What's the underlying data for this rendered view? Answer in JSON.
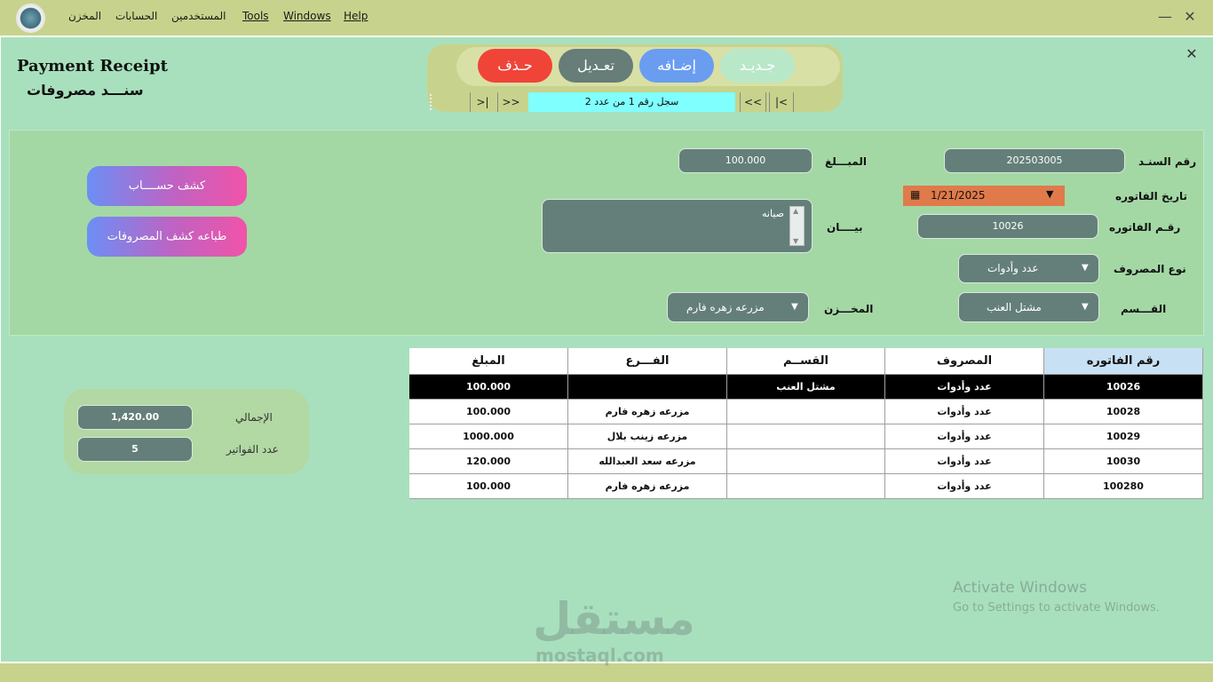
{
  "menu": {
    "store": "المخزن",
    "accounts": "الحسابات",
    "users": "المستخدمين",
    "tools": "Tools",
    "windows": "Windows",
    "help": "Help"
  },
  "window_controls": {
    "minimize": "—",
    "close": "✕"
  },
  "form_close": "✕",
  "title": {
    "en": "Payment Receipt",
    "ar": "سنـــد مصروفات"
  },
  "toolbar": {
    "new_label": "جـديـد",
    "add_label": "إضـافه",
    "edit_label": "تعـديل",
    "delete_label": "حـذف"
  },
  "nav": {
    "first": "|<",
    "prev": "<<",
    "next": ">>",
    "last": ">|",
    "record_info": "سجل رقم   1   من عدد   2"
  },
  "form": {
    "voucher_no_label": "رقم السنـد",
    "voucher_no": "202503005",
    "amount_label": "المبـــلغ",
    "amount": "100.000",
    "invoice_date_label": "تاريخ الفاتوره",
    "invoice_date": "1/21/2025",
    "invoice_no_label": "رقـم الفاتوره",
    "invoice_no": "10026",
    "description_label": "بيــــان",
    "description": "صيانه",
    "expense_type_label": "نوع المصروف",
    "expense_type": "عدد وأدوات",
    "section_label": "القـــسم",
    "section": "مشتل العنب",
    "store_label": "المخـــزن",
    "store": "مزرعه زهره فارم"
  },
  "buttons": {
    "account_statement": "كشف حســــاب",
    "print_expenses": "طباعه كشف المصروفات"
  },
  "totals": {
    "total_label": "الإجمالي",
    "total_value": "1,420.00",
    "count_label": "عدد الفواتير",
    "count_value": "5"
  },
  "grid": {
    "headers": [
      "رقم الفاتوره",
      "المصروف",
      "القســم",
      "الفـــرع",
      "المبلغ"
    ],
    "rows": [
      [
        "10026",
        "عدد وأدوات",
        "مشتل العنب",
        "",
        "100.000"
      ],
      [
        "10028",
        "عدد وأدوات",
        "",
        "مزرعه زهره فارم",
        "100.000"
      ],
      [
        "10029",
        "عدد وأدوات",
        "",
        "مزرعه زينب بلال",
        "1000.000"
      ],
      [
        "10030",
        "عدد وأدوات",
        "",
        "مزرعه سعد العبدالله",
        "120.000"
      ],
      [
        "100280",
        "عدد وأدوات",
        "",
        "مزرعه زهره فارم",
        "100.000"
      ]
    ]
  },
  "activation": {
    "title": "Activate Windows",
    "subtitle": "Go to Settings to activate Windows."
  },
  "watermark": {
    "ar": "مستقل",
    "en": "mostaql.com"
  },
  "colors": {
    "background": "#a8e0bd",
    "titlebar": "#c7d38c",
    "field": "#647f79",
    "date_field": "#e07a4a",
    "new_button": "#b8e8c8",
    "add_button": "#6a9df0",
    "edit_button": "#667d78",
    "delete_button": "#f04438",
    "record_info": "#80ffff",
    "grid_selected_row": "#000000",
    "grid_active_header": "#c8e0f4"
  }
}
